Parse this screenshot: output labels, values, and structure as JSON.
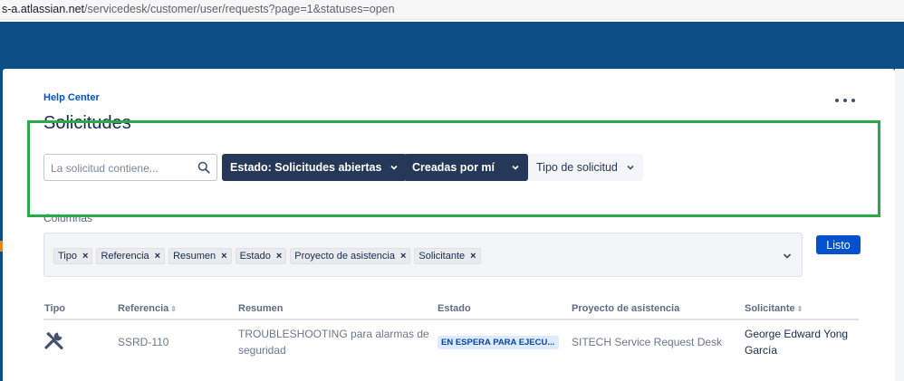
{
  "browser": {
    "url_prefix": "s-a.atlassian.net",
    "url_path": "/servicedesk/customer/user/requests?page=1&statuses=open"
  },
  "colors": {
    "header_blue": "#0b4f86",
    "dark_button": "#253858",
    "primary_button": "#0052cc",
    "highlight_border": "#2ba84a",
    "status_bg": "#deebff",
    "status_text": "#0747a6"
  },
  "breadcrumb": "Help Center",
  "page": {
    "title": "Solicitudes"
  },
  "more_menu_icon": "ellipsis-icon",
  "filters": {
    "search_placeholder": "La solicitud contiene...",
    "status_label": "Estado: Solicitudes abiertas",
    "created_by_label": "Creadas por mí",
    "request_type_label": "Tipo de solicitud"
  },
  "columns_panel": {
    "label": "Columnas",
    "chips": [
      "Tipo",
      "Referencia",
      "Resumen",
      "Estado",
      "Proyecto de asistencia",
      "Solicitante"
    ],
    "remove_glyph": "×",
    "done_label": "Listo"
  },
  "table": {
    "headers": {
      "tipo": "Tipo",
      "referencia": "Referencia",
      "resumen": "Resumen",
      "estado": "Estado",
      "proyecto": "Proyecto de asistencia",
      "solicitante": "Solicitante"
    },
    "rows": [
      {
        "type_icon": "tools-icon",
        "reference": "SSRD-110",
        "summary_line1": "TROUBLESHOOTING para alarmas de",
        "summary_line2": "seguridad",
        "status": "EN ESPERA PARA EJECU...",
        "project": "SITECH Service Request Desk",
        "requester_line1": "George Edward Yong",
        "requester_line2": "García"
      }
    ]
  }
}
